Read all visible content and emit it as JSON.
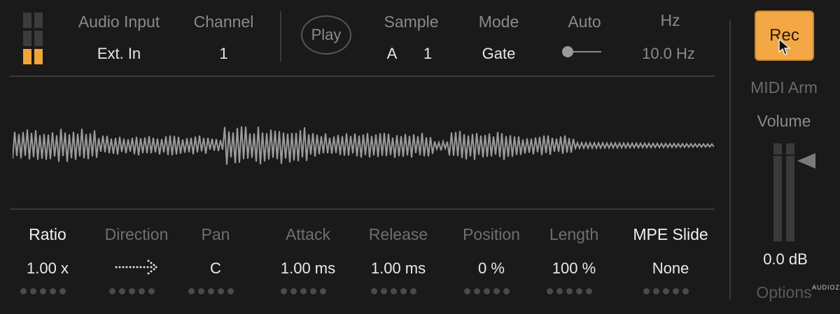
{
  "header": {
    "audio_input": {
      "label": "Audio Input",
      "value": "Ext. In"
    },
    "channel": {
      "label": "Channel",
      "value": "1"
    },
    "play_label": "Play",
    "sample": {
      "label": "Sample",
      "slot": "A",
      "number": "1"
    },
    "mode": {
      "label": "Mode",
      "value": "Gate"
    },
    "auto": {
      "label": "Auto",
      "enabled": false
    },
    "hz": {
      "label": "Hz",
      "value": "10.0 Hz"
    }
  },
  "input_meter": {
    "active_segments": 1,
    "total_segments": 4
  },
  "right_panel": {
    "rec_label": "Rec",
    "midi_arm_label": "MIDI Arm",
    "volume_label": "Volume",
    "volume_value": "0.0 dB",
    "options_label": "Options"
  },
  "params": [
    {
      "label": "Ratio",
      "value": "1.00 x",
      "highlight": true
    },
    {
      "label": "Direction",
      "value": "",
      "icon": "dotted-arrow-right-icon",
      "highlight": false
    },
    {
      "label": "Pan",
      "value": "C",
      "highlight": false
    },
    {
      "label": "Attack",
      "value": "1.00 ms",
      "highlight": false
    },
    {
      "label": "Release",
      "value": "1.00 ms",
      "highlight": false
    },
    {
      "label": "Position",
      "value": "0 %",
      "highlight": false
    },
    {
      "label": "Length",
      "value": "100 %",
      "highlight": false
    },
    {
      "label": "MPE Slide",
      "value": "None",
      "highlight": true
    }
  ],
  "watermark": "AUDIOZ",
  "colors": {
    "accent": "#f3a845",
    "background": "#1a1a1a",
    "waveform": "#9c9c9c"
  }
}
